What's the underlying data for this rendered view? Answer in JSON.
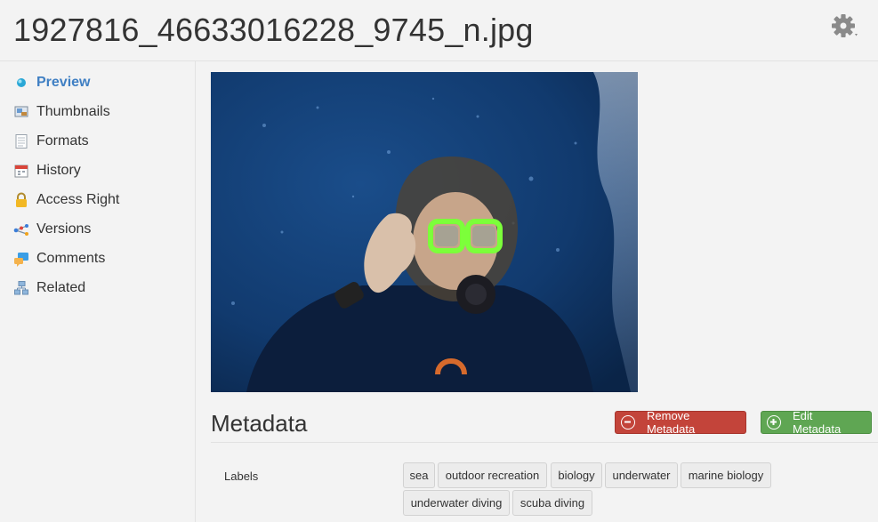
{
  "header": {
    "title": "1927816_46633016228_9745_n.jpg",
    "settings_icon": "gear-icon"
  },
  "sidebar": {
    "items": [
      {
        "label": "Preview",
        "icon": "preview-dot-icon",
        "active": true
      },
      {
        "label": "Thumbnails",
        "icon": "thumbnails-icon",
        "active": false
      },
      {
        "label": "Formats",
        "icon": "document-icon",
        "active": false
      },
      {
        "label": "History",
        "icon": "calendar-icon",
        "active": false
      },
      {
        "label": "Access Right",
        "icon": "lock-icon",
        "active": false
      },
      {
        "label": "Versions",
        "icon": "versions-icon",
        "active": false
      },
      {
        "label": "Comments",
        "icon": "comment-icon",
        "active": false
      },
      {
        "label": "Related",
        "icon": "related-icon",
        "active": false
      }
    ]
  },
  "metadata": {
    "title": "Metadata",
    "remove_label": "Remove Metadata",
    "edit_label": "Edit Metadata",
    "labels_caption": "Labels",
    "tags": [
      "sea",
      "outdoor recreation",
      "biology",
      "underwater",
      "marine biology",
      "underwater diving",
      "scuba diving"
    ]
  },
  "colors": {
    "accent": "#3f7fc3",
    "remove": "#c3443a",
    "edit": "#5fa653"
  }
}
